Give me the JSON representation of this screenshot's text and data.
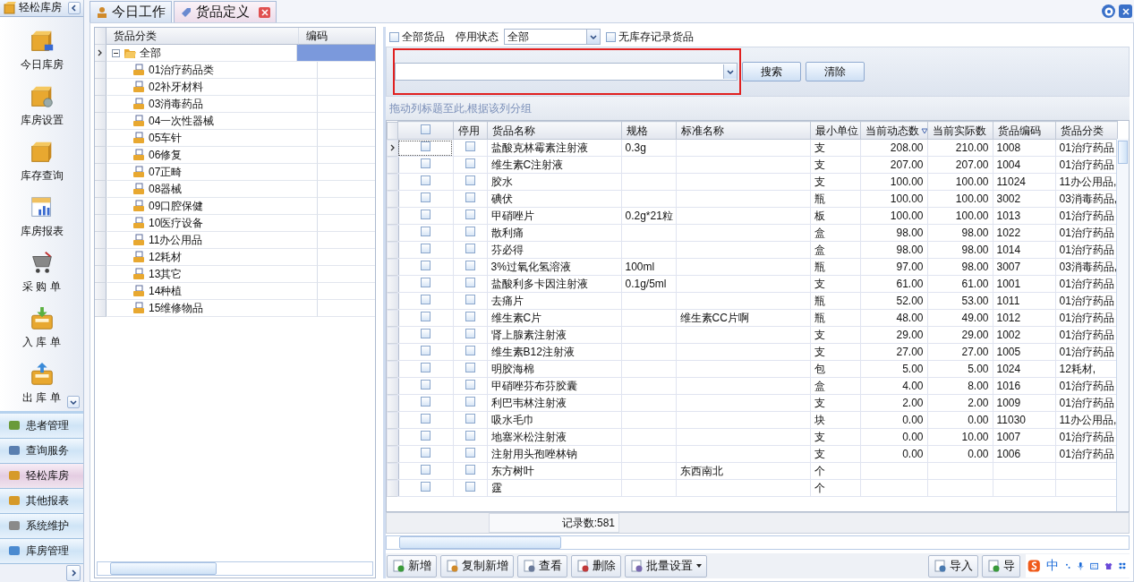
{
  "sidebar": {
    "title": "轻松库房",
    "nav_items": [
      {
        "label": "今日库房"
      },
      {
        "label": "库房设置"
      },
      {
        "label": "库存查询"
      },
      {
        "label": "库房报表"
      },
      {
        "label": "采 购 单"
      },
      {
        "label": "入 库 单"
      },
      {
        "label": "出 库 单"
      }
    ],
    "groups": [
      {
        "label": "患者管理",
        "selected": false
      },
      {
        "label": "查询服务",
        "selected": false
      },
      {
        "label": "轻松库房",
        "selected": true
      },
      {
        "label": "其他报表",
        "selected": false
      },
      {
        "label": "系统维护",
        "selected": false
      },
      {
        "label": "库房管理",
        "selected": false
      }
    ]
  },
  "tabs": [
    {
      "label": "今日工作",
      "selected": false,
      "closable": false
    },
    {
      "label": "货品定义",
      "selected": true,
      "closable": true
    }
  ],
  "tree": {
    "columns": [
      "货品分类",
      "编码"
    ],
    "root": {
      "label": "全部",
      "expanded": true,
      "selected": true,
      "children": [
        {
          "label": "01治疗药品类"
        },
        {
          "label": "02补牙材料"
        },
        {
          "label": "03消毒药品"
        },
        {
          "label": "04一次性器械"
        },
        {
          "label": "05车针"
        },
        {
          "label": "06修复"
        },
        {
          "label": "07正畸"
        },
        {
          "label": "08器械"
        },
        {
          "label": "09口腔保健"
        },
        {
          "label": "10医疗设备"
        },
        {
          "label": "11办公用品"
        },
        {
          "label": "12耗材"
        },
        {
          "label": "13其它"
        },
        {
          "label": "14种植"
        },
        {
          "label": "15维修物品"
        }
      ]
    }
  },
  "filter": {
    "all_goods": {
      "label": "全部货品",
      "checked": false
    },
    "status_label": "停用状态",
    "status_value": "全部",
    "no_stock": {
      "label": "无库存记录货品",
      "checked": false
    }
  },
  "search": {
    "buttons": [
      "搜索",
      "清除"
    ]
  },
  "group_hint": "拖动列标题至此,根据该列分组",
  "grid": {
    "header_checked": false,
    "flag_column": "停用",
    "columns": [
      {
        "label": "货品名称"
      },
      {
        "label": "规格"
      },
      {
        "label": "标准名称"
      },
      {
        "label": "最小单位"
      },
      {
        "label": "当前动态数",
        "sorted_descending": true
      },
      {
        "label": "当前实际数"
      },
      {
        "label": "货品编码"
      },
      {
        "label": "货品分类"
      }
    ],
    "rows": [
      {
        "selected": true,
        "checked": false,
        "disabled": false,
        "cells": [
          "盐酸克林霉素注射液",
          "0.3g",
          null,
          "支",
          "208.00",
          "210.00",
          "1008",
          "01治疗药品"
        ]
      },
      {
        "selected": false,
        "checked": false,
        "disabled": false,
        "cells": [
          "维生素C注射液",
          null,
          null,
          "支",
          "207.00",
          "207.00",
          "1004",
          "01治疗药品"
        ]
      },
      {
        "selected": false,
        "checked": false,
        "disabled": false,
        "cells": [
          "胶水",
          null,
          null,
          "支",
          "100.00",
          "100.00",
          "11024",
          "11办公用品,"
        ]
      },
      {
        "selected": false,
        "checked": false,
        "disabled": false,
        "cells": [
          "碘伏",
          null,
          null,
          "瓶",
          "100.00",
          "100.00",
          "3002",
          "03消毒药品,"
        ]
      },
      {
        "selected": false,
        "checked": false,
        "disabled": false,
        "cells": [
          "甲硝唑片",
          "0.2g*21粒",
          null,
          "板",
          "100.00",
          "100.00",
          "1013",
          "01治疗药品"
        ]
      },
      {
        "selected": false,
        "checked": false,
        "disabled": false,
        "cells": [
          "散利痛",
          null,
          null,
          "盒",
          "98.00",
          "98.00",
          "1022",
          "01治疗药品"
        ]
      },
      {
        "selected": false,
        "checked": false,
        "disabled": false,
        "cells": [
          "芬必得",
          null,
          null,
          "盒",
          "98.00",
          "98.00",
          "1014",
          "01治疗药品"
        ]
      },
      {
        "selected": false,
        "checked": false,
        "disabled": false,
        "cells": [
          "3%过氧化氢溶液",
          "100ml",
          null,
          "瓶",
          "97.00",
          "98.00",
          "3007",
          "03消毒药品,"
        ]
      },
      {
        "selected": false,
        "checked": false,
        "disabled": false,
        "cells": [
          "盐酸利多卡因注射液",
          "0.1g/5ml",
          null,
          "支",
          "61.00",
          "61.00",
          "1001",
          "01治疗药品"
        ]
      },
      {
        "selected": false,
        "checked": false,
        "disabled": false,
        "cells": [
          "去痛片",
          null,
          null,
          "瓶",
          "52.00",
          "53.00",
          "1011",
          "01治疗药品"
        ]
      },
      {
        "selected": false,
        "checked": false,
        "disabled": false,
        "cells": [
          "维生素C片",
          null,
          "维生素CC片啊",
          "瓶",
          "48.00",
          "49.00",
          "1012",
          "01治疗药品"
        ]
      },
      {
        "selected": false,
        "checked": false,
        "disabled": false,
        "cells": [
          "肾上腺素注射液",
          null,
          null,
          "支",
          "29.00",
          "29.00",
          "1002",
          "01治疗药品"
        ]
      },
      {
        "selected": false,
        "checked": false,
        "disabled": false,
        "cells": [
          "维生素B12注射液",
          null,
          null,
          "支",
          "27.00",
          "27.00",
          "1005",
          "01治疗药品"
        ]
      },
      {
        "selected": false,
        "checked": false,
        "disabled": false,
        "cells": [
          "明胶海棉",
          null,
          null,
          "包",
          "5.00",
          "5.00",
          "1024",
          "12耗材,"
        ]
      },
      {
        "selected": false,
        "checked": false,
        "disabled": false,
        "cells": [
          "甲硝唑芬布芬胶囊",
          null,
          null,
          "盒",
          "4.00",
          "8.00",
          "1016",
          "01治疗药品"
        ]
      },
      {
        "selected": false,
        "checked": false,
        "disabled": false,
        "cells": [
          "利巴韦林注射液",
          null,
          null,
          "支",
          "2.00",
          "2.00",
          "1009",
          "01治疗药品"
        ]
      },
      {
        "selected": false,
        "checked": false,
        "disabled": false,
        "cells": [
          "吸水毛巾",
          null,
          null,
          "块",
          "0.00",
          "0.00",
          "11030",
          "11办公用品,"
        ]
      },
      {
        "selected": false,
        "checked": false,
        "disabled": false,
        "cells": [
          "地塞米松注射液",
          null,
          null,
          "支",
          "0.00",
          "10.00",
          "1007",
          "01治疗药品"
        ]
      },
      {
        "selected": false,
        "checked": false,
        "disabled": false,
        "cells": [
          "注射用头孢唑林钠",
          null,
          null,
          "支",
          "0.00",
          "0.00",
          "1006",
          "01治疗药品"
        ]
      },
      {
        "selected": false,
        "checked": false,
        "disabled": false,
        "cells": [
          "东方树叶",
          null,
          "东西南北",
          "个",
          null,
          null,
          null,
          null
        ]
      },
      {
        "selected": false,
        "checked": false,
        "disabled": false,
        "cells": [
          "霆",
          null,
          null,
          "个",
          null,
          null,
          null,
          null
        ]
      }
    ],
    "record_count": "记录数:581"
  },
  "toolbar": {
    "left": [
      {
        "label": "新增",
        "kind": "add"
      },
      {
        "label": "复制新增",
        "kind": "copy"
      },
      {
        "label": "查看",
        "kind": "view"
      },
      {
        "label": "删除",
        "kind": "delete"
      },
      {
        "label": "批量设置",
        "kind": "menu"
      }
    ],
    "right": [
      {
        "label": "导入",
        "kind": "import"
      },
      {
        "label": "导",
        "kind": "export"
      }
    ]
  },
  "ime": {
    "mode": "中"
  }
}
